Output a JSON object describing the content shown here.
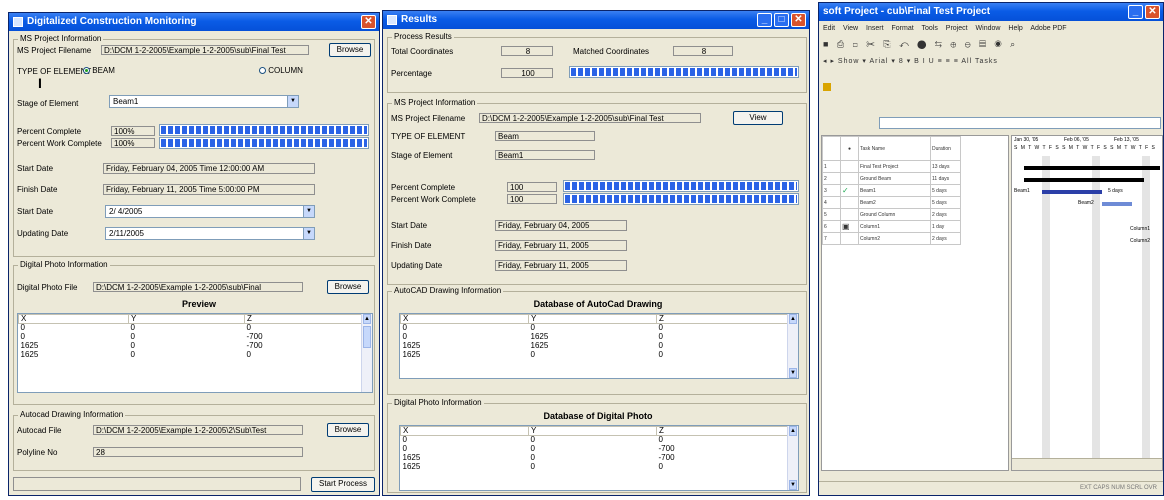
{
  "left_window": {
    "title": "Digitalized Construction Monitoring",
    "ms_project_group": "MS Project Information",
    "filename_label": "MS Project Filename",
    "filename_value": "D:\\DCM 1-2-2005\\Example 1-2-2005\\sub\\Final Test",
    "browse_label": "Browse",
    "type_label": "TYPE OF ELEMENT",
    "beam_label": "BEAM",
    "column_label": "COLUMN",
    "stage_label": "Stage of Element",
    "stage_value": "Beam1",
    "percent_complete_label": "Percent Complete",
    "percent_complete_value": "100%",
    "percent_complete_fraction": 1.0,
    "percent_work_label": "Percent Work Complete",
    "percent_work_value": "100%",
    "percent_work_fraction": 1.0,
    "start_label": "Start Date",
    "start_value": "Friday, February 04, 2005 Time 12:00:00 AM",
    "finish_label": "Finish Date",
    "finish_value": "Friday, February 11, 2005 Time 5:00:00 PM",
    "start_date_label": "Start Date",
    "start_date_value": "2/ 4/2005",
    "updating_label": "Updating Date",
    "updating_value": "2/11/2005",
    "photo_group": "Digital Photo Information",
    "photo_file_label": "Digital Photo File",
    "photo_file_value": "D:\\DCM 1-2-2005\\Example 1-2-2005\\sub\\Final",
    "photo_browse": "Browse",
    "preview_label": "Preview",
    "preview_headers": [
      "X",
      "Y",
      "Z"
    ],
    "preview_rows": [
      [
        "0",
        "0",
        "0"
      ],
      [
        "0",
        "0",
        "-700"
      ],
      [
        "1625",
        "0",
        "-700"
      ],
      [
        "1625",
        "0",
        "0"
      ]
    ],
    "autocad_group": "Autocad Drawing Information",
    "autocad_file_label": "Autocad File",
    "autocad_file_value": "D:\\DCM 1-2-2005\\Example 1-2-2005\\2\\Sub\\Test",
    "autocad_browse": "Browse",
    "polyline_label": "Polyline No",
    "polyline_value": "28",
    "start_process": "Start Process"
  },
  "mid_window": {
    "title": "Results",
    "process_group": "Process Results",
    "total_coords_label": "Total Coordinates",
    "total_coords_value": "8",
    "matched_coords_label": "Matched Coordinates",
    "matched_coords_value": "8",
    "percentage_label": "Percentage",
    "percentage_value": "100",
    "percentage_fraction": 1.0,
    "ms_group": "MS Project Information",
    "filename_label": "MS Project Filename",
    "filename_value": "D:\\DCM 1-2-2005\\Example 1-2-2005\\sub\\Final Test",
    "view_label": "View",
    "type_label": "TYPE OF ELEMENT",
    "type_value": "Beam",
    "stage_label": "Stage of Element",
    "stage_value": "Beam1",
    "pc_label": "Percent Complete",
    "pc_value": "100",
    "pc_fraction": 1.0,
    "pwc_label": "Percent Work Complete",
    "pwc_value": "100",
    "pwc_fraction": 1.0,
    "start_label": "Start Date",
    "start_value": "Friday, February 04, 2005",
    "finish_label": "Finish Date",
    "finish_value": "Friday, February 11, 2005",
    "updating_label": "Updating Date",
    "updating_value": "Friday, February 11, 2005",
    "autocad_group": "AutoCAD Drawing Information",
    "autocad_db_title": "Database of AutoCad Drawing",
    "autocad_headers": [
      "X",
      "Y",
      "Z"
    ],
    "autocad_rows": [
      [
        "0",
        "0",
        "0"
      ],
      [
        "0",
        "1625",
        "0"
      ],
      [
        "1625",
        "1625",
        "0"
      ],
      [
        "1625",
        "0",
        "0"
      ]
    ],
    "photo_group": "Digital Photo Information",
    "photo_db_title": "Database of Digital Photo",
    "photo_headers": [
      "X",
      "Y",
      "Z"
    ],
    "photo_rows": [
      [
        "0",
        "0",
        "0"
      ],
      [
        "0",
        "0",
        "-700"
      ],
      [
        "1625",
        "0",
        "-700"
      ],
      [
        "1625",
        "0",
        "0"
      ]
    ]
  },
  "right_window": {
    "title": "soft Project - cub\\Final Test Project",
    "menu": [
      "Edit",
      "View",
      "Insert",
      "Format",
      "Tools",
      "Project",
      "Window",
      "Help",
      "Adobe PDF"
    ],
    "toolbar1": "■ ⎙ ◻ ✂ ⎘ ↶ ⬤ ⇆ ⊕ ⊖ ▤ ◉ ⌕",
    "toolbar2": "◂ ▸ Show ▾  Arial   ▾ 8 ▾  B I U  ≡ ≡ ≡  All Tasks",
    "task_header": "Task Name",
    "duration_header": "Duration",
    "tasks": [
      {
        "id": "1",
        "name": "Final Test Project",
        "duration": "13 days"
      },
      {
        "id": "2",
        "name": "Ground Beam",
        "duration": "11 days"
      },
      {
        "id": "3",
        "name": "Beam1",
        "duration": "5 days"
      },
      {
        "id": "4",
        "name": "Beam2",
        "duration": "5 days"
      },
      {
        "id": "5",
        "name": "Ground Column",
        "duration": "2 days"
      },
      {
        "id": "6",
        "name": "Column1",
        "duration": "1 day"
      },
      {
        "id": "7",
        "name": "Column2",
        "duration": "2 days"
      }
    ],
    "gantt_labels": [
      "Beam1",
      "Beam2",
      "Column1",
      "Column2",
      "5 days"
    ],
    "week_headers": [
      "Jan 30, '05",
      "Feb 06, '05",
      "Feb 13, '05"
    ],
    "day_letters": "S M T W T F S S M T W T F S S M T W T F S",
    "status_text": "EXT  CAPS  NUM  SCRL  OVR"
  },
  "colors": {
    "titlebar": "#0a5ce6",
    "window_bg": "#ece9d8",
    "progress": "#2a63e6",
    "close_button": "#d9532c"
  }
}
